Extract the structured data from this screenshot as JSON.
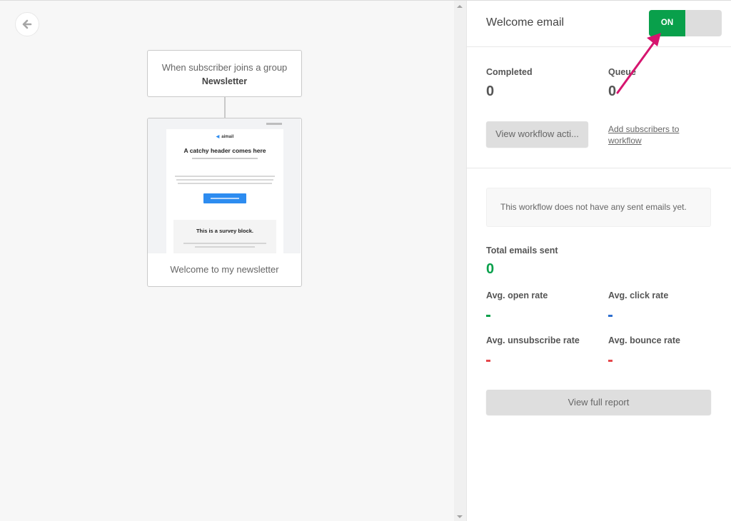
{
  "canvas": {
    "back_button_icon": "arrow-left-icon",
    "trigger": {
      "line1": "When subscriber joins a group",
      "group": "Newsletter"
    },
    "email_step": {
      "preview": {
        "logo_text": "aimail",
        "header": "A catchy header comes here",
        "survey_title": "This is a survey block."
      },
      "label": "Welcome to my newsletter"
    }
  },
  "panel": {
    "title": "Welcome email",
    "toggle": {
      "label": "ON",
      "state": "on",
      "color": "#09a04b"
    },
    "stats": {
      "completed_label": "Completed",
      "completed_value": "0",
      "queue_label": "Queue",
      "queue_value": "0"
    },
    "view_activity_button": "View workflow acti...",
    "add_subscribers_link": "Add subscribers to workflow",
    "notice": "This workflow does not have any sent emails yet.",
    "total_sent_label": "Total emails sent",
    "total_sent_value": "0",
    "rates": [
      {
        "label": "Avg. open rate",
        "value": "-",
        "color": "#09a04b"
      },
      {
        "label": "Avg. click rate",
        "value": "-",
        "color": "#2f6fcf"
      },
      {
        "label": "Avg. unsubscribe rate",
        "value": "-",
        "color": "#e5474b"
      },
      {
        "label": "Avg. bounce rate",
        "value": "-",
        "color": "#e5474b"
      }
    ],
    "full_report_button": "View full report"
  },
  "annotation": {
    "color": "#d6156f"
  }
}
